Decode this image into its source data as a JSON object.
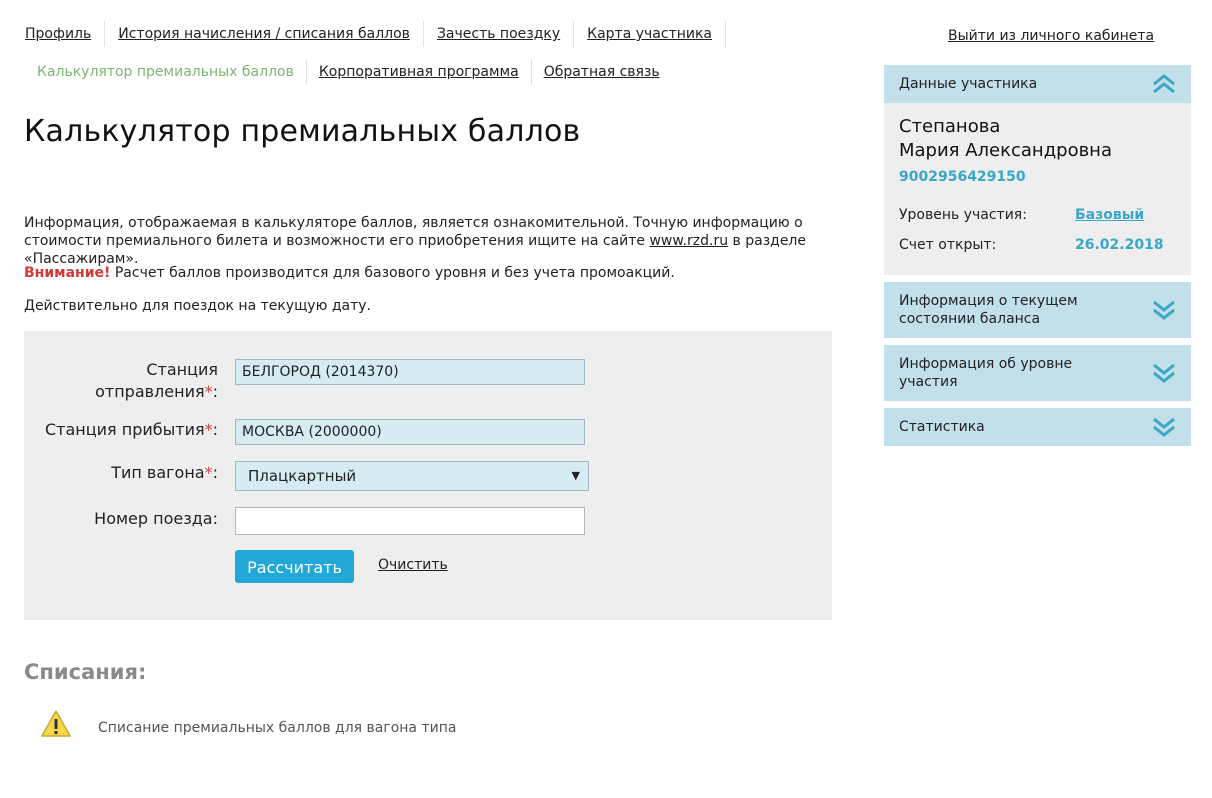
{
  "nav": {
    "row1": [
      "Профиль",
      "История начисления / списания баллов",
      "Зачесть поездку",
      "Карта участника"
    ],
    "row2": [
      "Калькулятор премиальных баллов",
      "Корпоративная программа",
      "Обратная связь"
    ],
    "logout": "Выйти из личного кабинета"
  },
  "page": {
    "title": "Калькулятор премиальных баллов",
    "info_part1": "Информация, отображаемая в калькуляторе баллов, является ознакомительной. Точную информацию о стоимости премиального билета и возможности его приобретения ищите на сайте",
    "info_link": "www.rzd.ru",
    "info_part2": "в разделе «Пассажирам».",
    "warning_label": "Внимание!",
    "warning_text": "Расчет баллов производится для базового уровня и без учета промоакций.",
    "valid_text": "Действительно для поездок на текущую дату."
  },
  "form": {
    "departure_label_1": "Станция",
    "departure_label_2": "отправления",
    "departure_value": "БЕЛГОРОД (2014370)",
    "arrival_label": "Станция прибытия",
    "arrival_value": "МОСКВА (2000000)",
    "car_type_label": "Тип вагона",
    "car_type_value": "Плацкартный",
    "train_number_label": "Номер поезда:",
    "train_number_value": "",
    "required_mark": "*",
    "colon": ":",
    "calculate_button": "Рассчитать",
    "clear_link": "Очистить"
  },
  "writeoffs": {
    "title": "Списания:",
    "message": "Списание премиальных баллов для вагона типа"
  },
  "sidebar": {
    "member_header": "Данные участника",
    "name_line1": "Степанова",
    "name_line2": "Мария Александровна",
    "card_number": "9002956429150",
    "level_label": "Уровень участия:",
    "level_value": "Базовый",
    "opened_label": "Счет открыт:",
    "opened_value": "26.02.2018",
    "balance_header": "Информация о текущем состоянии баланса",
    "level_info_header": "Информация об уровне участия",
    "stats_header": "Статистика"
  },
  "colors": {
    "accent_blue": "#22a8d6",
    "active_nav_green": "#7cb66e",
    "warning_red": "#d23a3a",
    "sidebar_header_bg": "#c2e0ea"
  }
}
